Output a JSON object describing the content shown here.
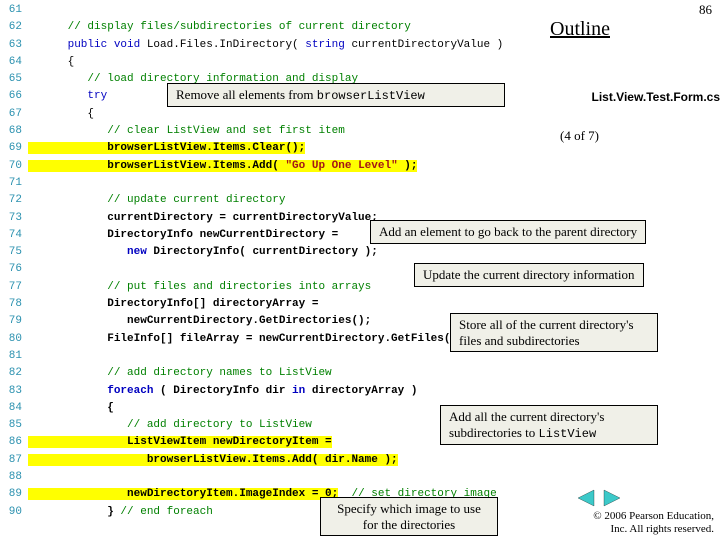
{
  "slide_number": "86",
  "outline_title": "Outline",
  "file_label": "List.View.Test.Form.cs",
  "page_counter": "(4 of 7)",
  "linenumbers": "61\n62\n63\n64\n65\n66\n67\n68\n69\n70\n71\n72\n73\n74\n75\n76\n77\n78\n79\n80\n81\n82\n83\n84\n85\n86\n87\n88\n89\n90",
  "code": {
    "l62": "      // display files/subdirectories of current directory",
    "l63_kw": "      public void",
    "l63_rest": " Load.Files.InDirectory( ",
    "l63_kw2": "string",
    "l63_rest2": " currentDirectoryValue )",
    "l64": "      {",
    "l65": "         // load directory information and display",
    "l66_kw": "         try",
    "l67": "         {",
    "l68": "            // clear ListView and set first item",
    "l69": "            browserListView.Items.Clear();",
    "l70a": "            browserListView.Items.Add( ",
    "l70b": "\"Go Up One Level\"",
    "l70c": " );",
    "l72": "            // update current directory",
    "l73": "            currentDirectory = currentDirectoryValue;",
    "l74": "            DirectoryInfo newCurrentDirectory =",
    "l75_kw": "               new",
    "l75_rest": " DirectoryInfo( currentDirectory );",
    "l77": "            // put files and directories into arrays",
    "l78": "            DirectoryInfo[] directoryArray =",
    "l79": "               newCurrentDirectory.GetDirectories();",
    "l80": "            FileInfo[] fileArray = newCurrentDirectory.GetFiles();",
    "l82": "            // add directory names to ListView",
    "l83_kw": "            foreach",
    "l83_rest": " ( DirectoryInfo dir ",
    "l83_kw2": "in",
    "l83_rest2": " directoryArray )",
    "l84": "            {",
    "l85": "               // add directory to ListView",
    "l86": "               ListViewItem newDirectoryItem =",
    "l87": "                  browserListView.Items.Add( dir.Name );",
    "l89a": "               newDirectoryItem.ImageIndex = 0;",
    "l89b": "  // set directory image",
    "l90a": "            } ",
    "l90b": "// end foreach"
  },
  "callouts": {
    "c1a": "Remove all elements from ",
    "c1b": "browserListView",
    "c2": "Add an element to go back to the parent directory",
    "c3": "Update the current directory information",
    "c4": "Store all of the current directory's files and subdirectories",
    "c5a": "Add all the current directory's subdirectories to ",
    "c5b": "ListView",
    "c6": "Specify which image to use for the directories"
  },
  "copyright": {
    "l1": "© 2006 Pearson Education,",
    "l2": "Inc.  All rights reserved."
  }
}
